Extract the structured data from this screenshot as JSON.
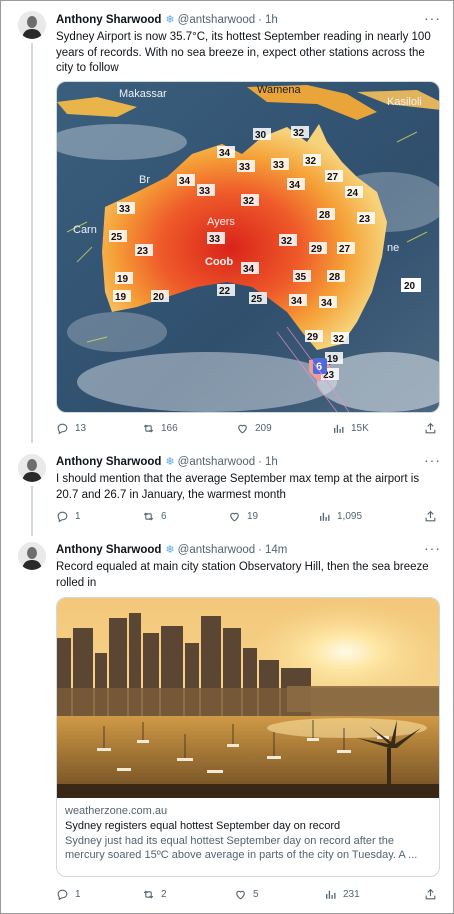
{
  "tweets": [
    {
      "name": "Anthony Sharwood",
      "handle": "@antsharwood",
      "time": "1h",
      "text": "Sydney Airport is now 35.7°C, its hottest September reading in nearly 100 years of records.  With no sea breeze in, expect other stations across the city to follow",
      "stats": {
        "replies": "13",
        "retweets": "166",
        "likes": "209",
        "views": "15K"
      },
      "map_labels": [
        "Makassar",
        "Wamena",
        "Kasiloli",
        "Ayers",
        "Coob",
        "Carn",
        "Br",
        "ne",
        "20",
        "6"
      ]
    },
    {
      "name": "Anthony Sharwood",
      "handle": "@antsharwood",
      "time": "1h",
      "text": "I should mention that the average September max temp at the airport is 20.7 and 26.7 in January, the warmest month",
      "stats": {
        "replies": "1",
        "retweets": "6",
        "likes": "19",
        "views": "1,095"
      }
    },
    {
      "name": "Anthony Sharwood",
      "handle": "@antsharwood",
      "time": "14m",
      "text": "Record equaled at main city station Observatory Hill, then the sea breeze rolled in",
      "card": {
        "domain": "weatherzone.com.au",
        "title": "Sydney registers equal hottest September day on record",
        "description": "Sydney just had its equal hottest September day on record after the mercury soared 15ºC above average in parts of the city on Tuesday. A ..."
      },
      "stats": {
        "replies": "1",
        "retweets": "2",
        "likes": "5",
        "views": "231"
      }
    }
  ],
  "icons": {
    "verified_badge": "snowflake-icon",
    "more": "more-icon",
    "reply": "reply-icon",
    "retweet": "retweet-icon",
    "like": "heart-icon",
    "views": "views-icon",
    "share": "share-icon"
  },
  "colors": {
    "badge": "#58a9e6",
    "secondary_text": "#536471",
    "thread_line": "#cfd9de"
  }
}
